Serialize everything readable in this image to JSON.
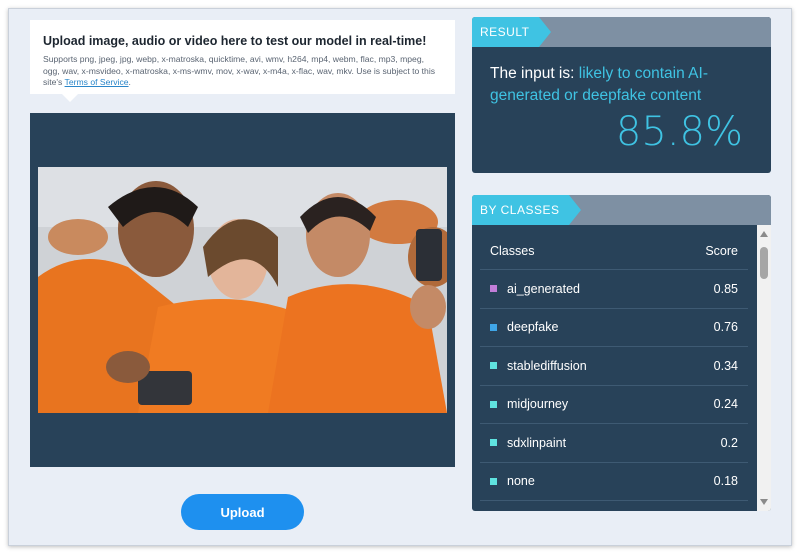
{
  "upload": {
    "title": "Upload image, audio or video here to test our model in real-time!",
    "description": "Supports png, jpeg, jpg, webp, x-matroska, quicktime, avi, wmv, h264, mp4, webm, flac, mp3, mpeg, ogg, wav, x-msvideo, x-matroska, x-ms-wmv, mov, x-wav, x-m4a, x-flac, wav, mkv. Use is subject to this site's ",
    "terms_link": "Terms of Service",
    "terms_suffix": ".",
    "button_label": "Upload"
  },
  "result": {
    "tab_label": "RESULT",
    "prefix": "The input is: ",
    "verdict": "likely to contain AI-generated or deepfake content",
    "score": "85.8%"
  },
  "classes": {
    "tab_label": "BY CLASSES",
    "columns": [
      "Classes",
      "Score"
    ],
    "rows": [
      {
        "name": "ai_generated",
        "score": "0.85",
        "color": "#c27ed9"
      },
      {
        "name": "deepfake",
        "score": "0.76",
        "color": "#3fa6e8"
      },
      {
        "name": "stablediffusion",
        "score": "0.34",
        "color": "#5fe3e0"
      },
      {
        "name": "midjourney",
        "score": "0.24",
        "color": "#5fe3e0"
      },
      {
        "name": "sdxlinpaint",
        "score": "0.2",
        "color": "#5fe3e0"
      },
      {
        "name": "none",
        "score": "0.18",
        "color": "#5fe3e0"
      }
    ]
  },
  "colors": {
    "accent": "#3fc3e3",
    "panel": "#284259",
    "button": "#1e90ef"
  }
}
